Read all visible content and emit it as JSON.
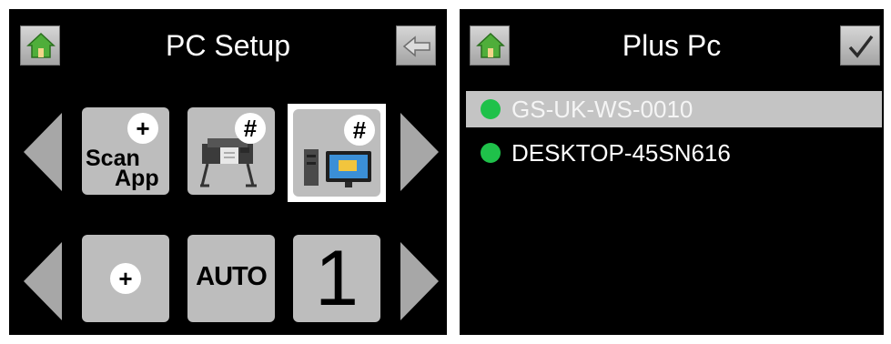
{
  "left_screen": {
    "title": "PC Setup",
    "home_icon": "home-icon",
    "back_icon": "back-arrow-icon",
    "row1": {
      "tiles": [
        {
          "name": "scan-app-tile",
          "line1": "Scan",
          "line2": "App",
          "badge": "+"
        },
        {
          "name": "printer-tile",
          "badge": "#",
          "icon": "printer-icon"
        },
        {
          "name": "pc-tile",
          "badge": "#",
          "icon": "computer-icon",
          "selected": true
        }
      ]
    },
    "row2": {
      "tiles": [
        {
          "name": "add-tile",
          "badge": "+"
        },
        {
          "name": "auto-tile",
          "label": "AUTO"
        },
        {
          "name": "number-tile",
          "label": "1"
        }
      ]
    }
  },
  "right_screen": {
    "title": "Plus Pc",
    "home_icon": "home-icon",
    "confirm_icon": "checkmark-icon",
    "pcs": [
      {
        "name": "GS-UK-WS-0010",
        "selected": true,
        "status_color": "#1fc14a"
      },
      {
        "name": "DESKTOP-45SN616",
        "selected": false,
        "status_color": "#1fc14a"
      }
    ]
  },
  "colors": {
    "background": "#000000",
    "button_gray": "#bdbdbd",
    "arrow_gray": "#a7a7a7",
    "selection_gray": "#c4c4c4",
    "status_green": "#1fc14a"
  }
}
